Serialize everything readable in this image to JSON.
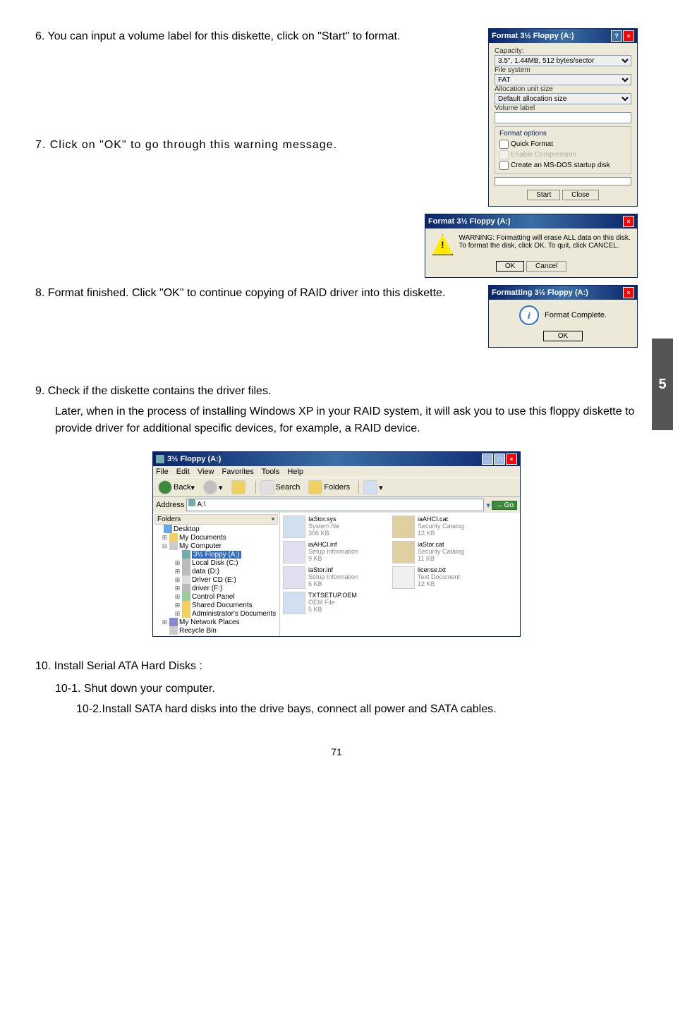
{
  "step6": "6. You can input a volume label for this diskette, click on \"Start\" to format.",
  "step7": "7. Click on \"OK\" to go through this warning message.",
  "step8": "8. Format finished. Click \"OK\" to continue copying of RAID driver into this diskette.",
  "step9_a": "9. Check if the diskette contains the driver files.",
  "step9_b": "Later, when in the process of installing Windows XP in your RAID system, it will ask you to use this floppy diskette to provide driver for additional specific devices, for example, a RAID device.",
  "step10": "10. Install Serial ATA Hard Disks :",
  "step10_1": "10-1. Shut down your computer.",
  "step10_2_lbl": "10-2. ",
  "step10_2_txt": "Install SATA hard disks into the drive bays, connect all power and SATA cables.",
  "pagenum": "71",
  "sidetab": "5",
  "format": {
    "title": "Format 3½ Floppy (A:)",
    "capacity_lbl": "Capacity:",
    "capacity_val": "3.5\", 1.44MB, 512 bytes/sector",
    "fs_lbl": "File system",
    "fs_val": "FAT",
    "alloc_lbl": "Allocation unit size",
    "alloc_val": "Default allocation size",
    "vol_lbl": "Volume label",
    "opts_title": "Format options",
    "quick": "Quick Format",
    "compress": "Enable Compression",
    "msdos": "Create an MS-DOS startup disk",
    "start": "Start",
    "close": "Close"
  },
  "warn": {
    "title": "Format 3½ Floppy (A:)",
    "msg1": "WARNING: Formatting will erase ALL data on this disk.",
    "msg2": "To format the disk, click OK. To quit, click CANCEL.",
    "ok": "OK",
    "cancel": "Cancel"
  },
  "done": {
    "title": "Formatting 3½ Floppy (A:)",
    "msg": "Format Complete.",
    "ok": "OK"
  },
  "explorer": {
    "title": "3½ Floppy (A:)",
    "menu": {
      "file": "File",
      "edit": "Edit",
      "view": "View",
      "fav": "Favorites",
      "tools": "Tools",
      "help": "Help"
    },
    "tb": {
      "back": "Back",
      "search": "Search",
      "folders": "Folders"
    },
    "addr_lbl": "Address",
    "addr_val": "A:\\",
    "go": "Go",
    "folders_hdr": "Folders",
    "tree": {
      "desktop": "Desktop",
      "mydocs": "My Documents",
      "mycomp": "My Computer",
      "floppy": "3½ Floppy (A:)",
      "localc": "Local Disk (C:)",
      "datad": "data (D:)",
      "drivercd": "Driver CD (E:)",
      "driverf": "driver (F:)",
      "cpanel": "Control Panel",
      "shared": "Shared Documents",
      "admin": "Administrator's Documents",
      "mynet": "My Network Places",
      "recycle": "Recycle Bin"
    },
    "files": [
      {
        "name": "IaStor.sys",
        "type": "System file",
        "size": "306 KB"
      },
      {
        "name": "iaAHCI.cat",
        "type": "Security Catalog",
        "size": "12 KB"
      },
      {
        "name": "iaAHCI.inf",
        "type": "Setup Information",
        "size": "9 KB"
      },
      {
        "name": "iaStor.cat",
        "type": "Security Catalog",
        "size": "11 KB"
      },
      {
        "name": "iaStor.inf",
        "type": "Setup Information",
        "size": "6 KB"
      },
      {
        "name": "license.txt",
        "type": "Text Document",
        "size": "12 KB"
      },
      {
        "name": "TXTSETUP.OEM",
        "type": "OEM File",
        "size": "5 KB"
      }
    ]
  }
}
